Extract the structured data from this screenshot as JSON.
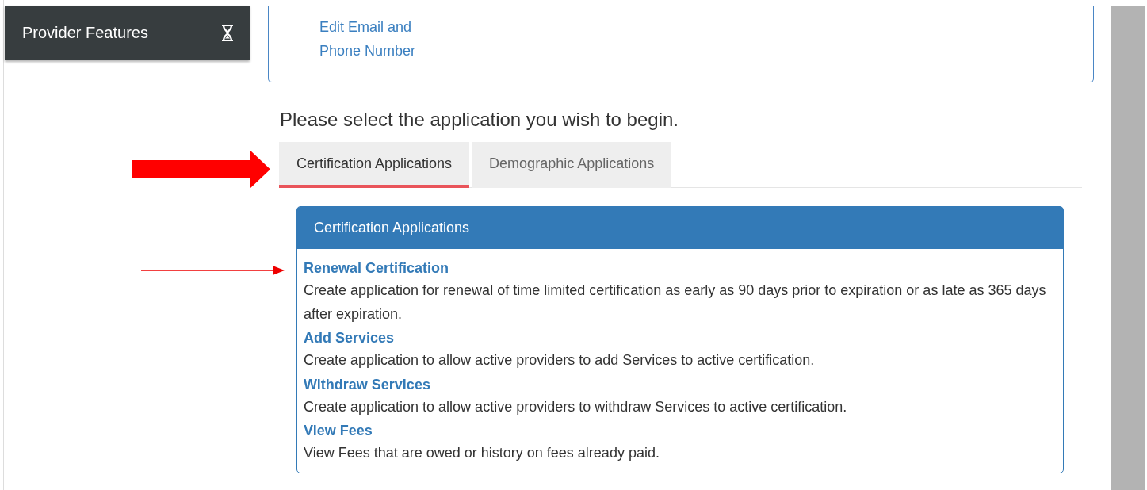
{
  "sidebar": {
    "title": "Provider Features"
  },
  "account_links": [
    "Edit Email and\nPhone Number"
  ],
  "heading": "Please select the application you wish to begin.",
  "tabs": [
    {
      "label": "Certification Applications",
      "selected": true
    },
    {
      "label": "Demographic Applications",
      "selected": false
    }
  ],
  "panel": {
    "title": "Certification Applications",
    "items": [
      {
        "title": "Renewal Certification",
        "description": "Create application for renewal of time limited certification as early as 90 days prior to expiration or as late as 365 days after expiration."
      },
      {
        "title": "Add Services",
        "description": "Create application to allow active providers to add Services to active certification."
      },
      {
        "title": "Withdraw Services",
        "description": "Create application to allow active providers to withdraw Services to active certification."
      },
      {
        "title": "View Fees",
        "description": "View Fees that are owed or history on fees already paid."
      }
    ]
  }
}
